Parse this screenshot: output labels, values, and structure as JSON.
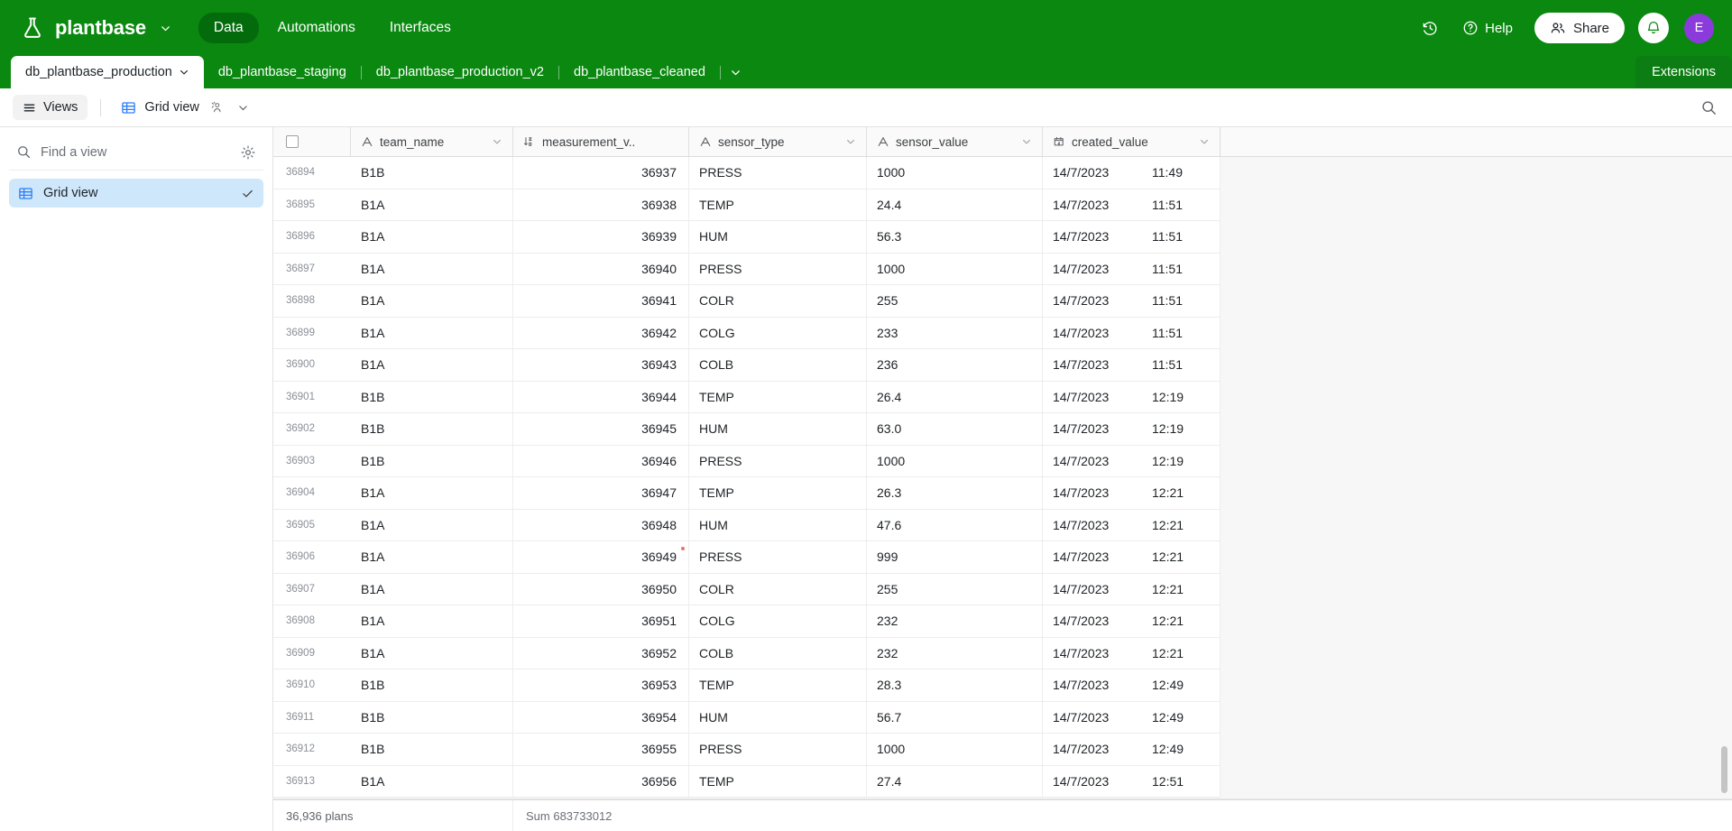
{
  "header": {
    "brand": "plantbase",
    "brand_icon": "flask-icon",
    "brand_chevron": "chevron-down-icon",
    "nav": [
      {
        "label": "Data",
        "active": true
      },
      {
        "label": "Automations",
        "active": false
      },
      {
        "label": "Interfaces",
        "active": false
      }
    ],
    "history_icon": "history-clock-icon",
    "help_label": "Help",
    "help_icon": "question-circle-icon",
    "share_label": "Share",
    "share_icon": "people-icon",
    "bell_icon": "bell-icon",
    "avatar_initial": "E",
    "avatar_color": "#8b3bdb",
    "bg_color": "#0a8810"
  },
  "table_tabs": {
    "tabs": [
      {
        "label": "db_plantbase_production",
        "active": true,
        "chevron": "chevron-down-icon"
      },
      {
        "label": "db_plantbase_staging",
        "active": false
      },
      {
        "label": "db_plantbase_production_v2",
        "active": false
      },
      {
        "label": "db_plantbase_cleaned",
        "active": false
      }
    ],
    "more_icon": "chevron-down-icon",
    "extensions_label": "Extensions"
  },
  "toolbar": {
    "views_label": "Views",
    "views_icon": "hamburger-icon",
    "gridview_label": "Grid view",
    "gridview_icon": "grid-table-icon",
    "collaborator_icon": "person-group-icon",
    "gridview_chevron": "chevron-down-icon",
    "search_icon": "search-icon"
  },
  "sidebar": {
    "search_placeholder": "Find a view",
    "search_value": "",
    "search_icon": "search-icon",
    "gear_icon": "gear-icon",
    "items": [
      {
        "label": "Grid view",
        "icon": "grid-table-icon",
        "selected": true,
        "check_icon": "check-icon"
      }
    ]
  },
  "grid": {
    "columns": [
      {
        "key": "rownum",
        "label": "",
        "icon": "checkbox-icon",
        "type": "rownum"
      },
      {
        "key": "team_name",
        "label": "team_name",
        "icon": "text-field-icon",
        "chevron": "chevron-down-icon"
      },
      {
        "key": "measurement_value",
        "label": "measurement_v..",
        "icon": "sort-number-icon",
        "chevron": ""
      },
      {
        "key": "sensor_type",
        "label": "sensor_type",
        "icon": "text-field-icon",
        "chevron": "chevron-down-icon"
      },
      {
        "key": "sensor_value",
        "label": "sensor_value",
        "icon": "text-field-icon",
        "chevron": "chevron-down-icon"
      },
      {
        "key": "created_value",
        "label": "created_value",
        "icon": "calendar-clock-icon",
        "chevron": "chevron-down-icon"
      }
    ],
    "rows": [
      {
        "rownum": "36894",
        "team_name": "B1B",
        "measurement_value": "36937",
        "sensor_type": "PRESS",
        "sensor_value": "1000",
        "created_date": "14/7/2023",
        "created_time": "11:49"
      },
      {
        "rownum": "36895",
        "team_name": "B1A",
        "measurement_value": "36938",
        "sensor_type": "TEMP",
        "sensor_value": "24.4",
        "created_date": "14/7/2023",
        "created_time": "11:51"
      },
      {
        "rownum": "36896",
        "team_name": "B1A",
        "measurement_value": "36939",
        "sensor_type": "HUM",
        "sensor_value": "56.3",
        "created_date": "14/7/2023",
        "created_time": "11:51"
      },
      {
        "rownum": "36897",
        "team_name": "B1A",
        "measurement_value": "36940",
        "sensor_type": "PRESS",
        "sensor_value": "1000",
        "created_date": "14/7/2023",
        "created_time": "11:51"
      },
      {
        "rownum": "36898",
        "team_name": "B1A",
        "measurement_value": "36941",
        "sensor_type": "COLR",
        "sensor_value": "255",
        "created_date": "14/7/2023",
        "created_time": "11:51"
      },
      {
        "rownum": "36899",
        "team_name": "B1A",
        "measurement_value": "36942",
        "sensor_type": "COLG",
        "sensor_value": "233",
        "created_date": "14/7/2023",
        "created_time": "11:51"
      },
      {
        "rownum": "36900",
        "team_name": "B1A",
        "measurement_value": "36943",
        "sensor_type": "COLB",
        "sensor_value": "236",
        "created_date": "14/7/2023",
        "created_time": "11:51"
      },
      {
        "rownum": "36901",
        "team_name": "B1B",
        "measurement_value": "36944",
        "sensor_type": "TEMP",
        "sensor_value": "26.4",
        "created_date": "14/7/2023",
        "created_time": "12:19"
      },
      {
        "rownum": "36902",
        "team_name": "B1B",
        "measurement_value": "36945",
        "sensor_type": "HUM",
        "sensor_value": "63.0",
        "created_date": "14/7/2023",
        "created_time": "12:19"
      },
      {
        "rownum": "36903",
        "team_name": "B1B",
        "measurement_value": "36946",
        "sensor_type": "PRESS",
        "sensor_value": "1000",
        "created_date": "14/7/2023",
        "created_time": "12:19"
      },
      {
        "rownum": "36904",
        "team_name": "B1A",
        "measurement_value": "36947",
        "sensor_type": "TEMP",
        "sensor_value": "26.3",
        "created_date": "14/7/2023",
        "created_time": "12:21"
      },
      {
        "rownum": "36905",
        "team_name": "B1A",
        "measurement_value": "36948",
        "sensor_type": "HUM",
        "sensor_value": "47.6",
        "created_date": "14/7/2023",
        "created_time": "12:21"
      },
      {
        "rownum": "36906",
        "team_name": "B1A",
        "measurement_value": "36949",
        "sensor_type": "PRESS",
        "sensor_value": "999",
        "created_date": "14/7/2023",
        "created_time": "12:21",
        "flag": true
      },
      {
        "rownum": "36907",
        "team_name": "B1A",
        "measurement_value": "36950",
        "sensor_type": "COLR",
        "sensor_value": "255",
        "created_date": "14/7/2023",
        "created_time": "12:21"
      },
      {
        "rownum": "36908",
        "team_name": "B1A",
        "measurement_value": "36951",
        "sensor_type": "COLG",
        "sensor_value": "232",
        "created_date": "14/7/2023",
        "created_time": "12:21"
      },
      {
        "rownum": "36909",
        "team_name": "B1A",
        "measurement_value": "36952",
        "sensor_type": "COLB",
        "sensor_value": "232",
        "created_date": "14/7/2023",
        "created_time": "12:21"
      },
      {
        "rownum": "36910",
        "team_name": "B1B",
        "measurement_value": "36953",
        "sensor_type": "TEMP",
        "sensor_value": "28.3",
        "created_date": "14/7/2023",
        "created_time": "12:49"
      },
      {
        "rownum": "36911",
        "team_name": "B1B",
        "measurement_value": "36954",
        "sensor_type": "HUM",
        "sensor_value": "56.7",
        "created_date": "14/7/2023",
        "created_time": "12:49"
      },
      {
        "rownum": "36912",
        "team_name": "B1B",
        "measurement_value": "36955",
        "sensor_type": "PRESS",
        "sensor_value": "1000",
        "created_date": "14/7/2023",
        "created_time": "12:49"
      },
      {
        "rownum": "36913",
        "team_name": "B1A",
        "measurement_value": "36956",
        "sensor_type": "TEMP",
        "sensor_value": "27.4",
        "created_date": "14/7/2023",
        "created_time": "12:51"
      }
    ],
    "footer": {
      "record_count": "36,936 plans",
      "sum_label": "Sum 683733012"
    }
  }
}
